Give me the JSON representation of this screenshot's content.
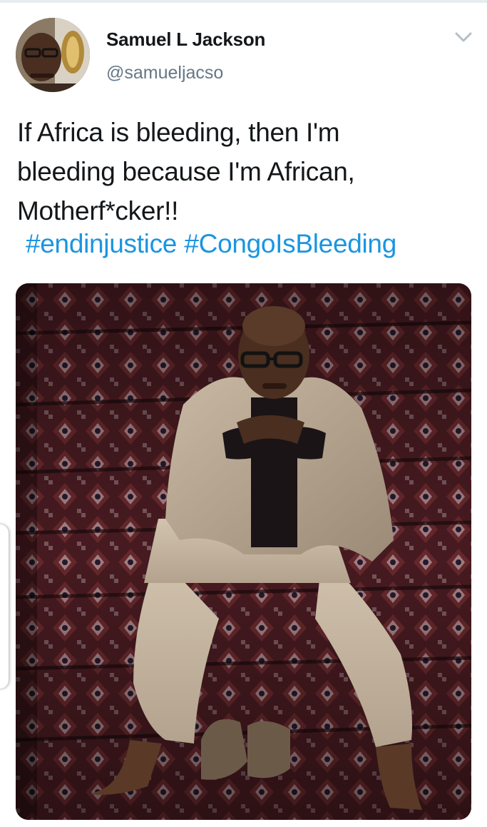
{
  "tweet": {
    "author": {
      "display_name": "Samuel L Jackson",
      "handle": "@samueljacso",
      "avatar_icon": "avatar-photo"
    },
    "menu_icon": "chevron-down-icon",
    "text_lines": [
      "If Africa is bleeding, then I'm",
      "bleeding because I'm African,",
      "Motherf*cker!!"
    ],
    "hashtags": [
      "#endinjustice",
      "#CongoIsBleeding"
    ],
    "media": {
      "type": "photo",
      "icon": "photo-image"
    }
  },
  "colors": {
    "text": "#14171a",
    "secondary": "#657786",
    "link": "#1b95e0",
    "background": "#ffffff"
  }
}
